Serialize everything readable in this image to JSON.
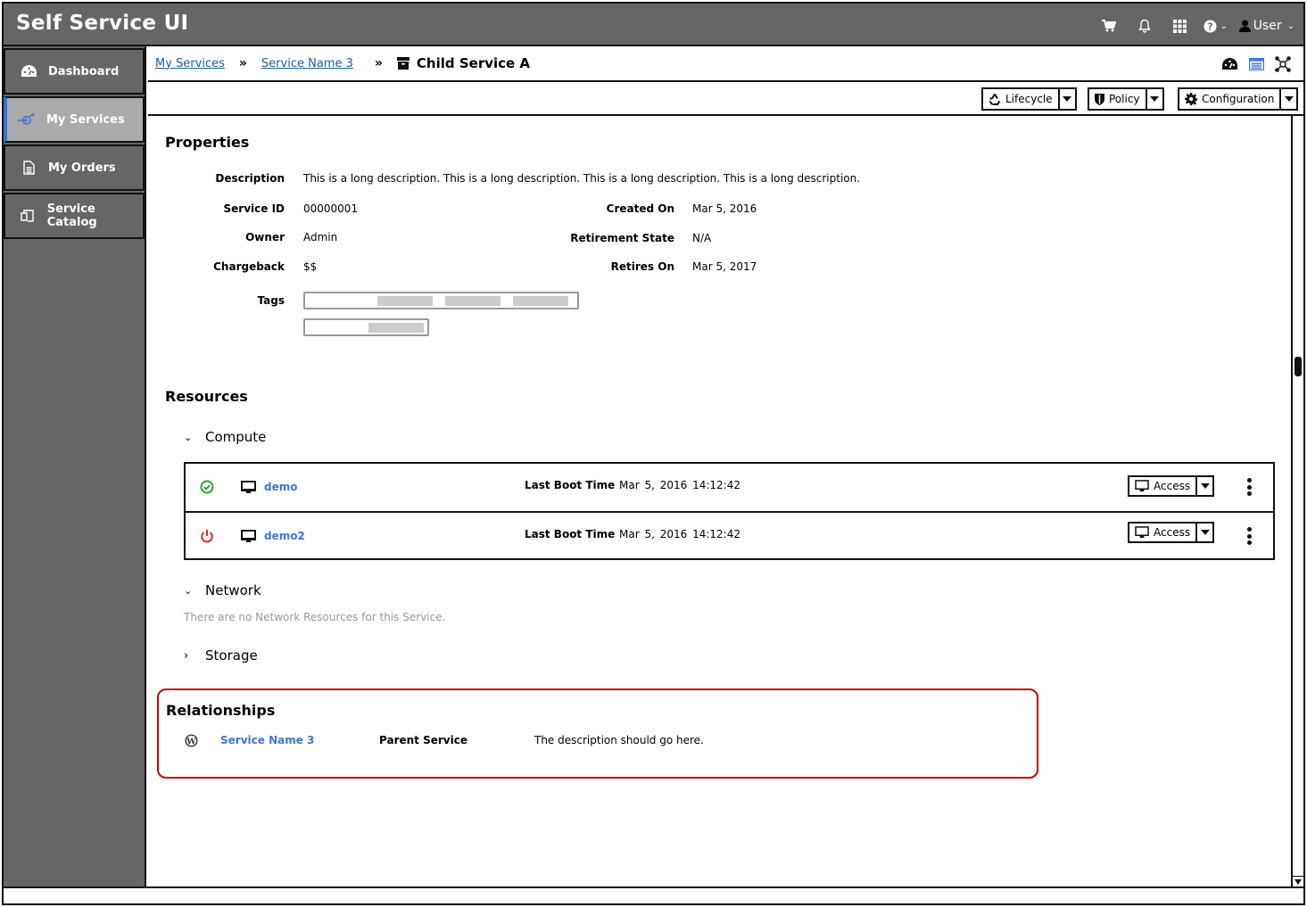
{
  "app": {
    "title": "Self Service UI",
    "header_icons": [
      {
        "name": "cart-icon"
      },
      {
        "name": "bell-icon"
      },
      {
        "name": "apps-grid-icon"
      },
      {
        "name": "help-icon"
      }
    ],
    "user_label": "User"
  },
  "sidebar": {
    "items": [
      {
        "label": "Dashboard",
        "icon": "dashboard-icon",
        "active": false
      },
      {
        "label": "My Services",
        "icon": "services-icon",
        "active": true
      },
      {
        "label": "My Orders",
        "icon": "document-icon",
        "active": false
      },
      {
        "label": "Service Catalog",
        "icon": "catalog-icon",
        "active": false
      }
    ]
  },
  "breadcrumb": {
    "items": [
      {
        "label": "My Services"
      },
      {
        "label": "Service Name 3"
      }
    ],
    "separator": "»",
    "current": "Child Service A"
  },
  "view_icons": [
    "dashboard-view-icon",
    "list-view-icon",
    "topology-view-icon"
  ],
  "toolbar": {
    "lifecycle": "Lifecycle",
    "policy": "Policy",
    "configuration": "Configuration"
  },
  "properties": {
    "title": "Properties",
    "description_label": "Description",
    "description": "This is a long description. This is a long description. This is a long description. This is a long description.",
    "service_id_label": "Service ID",
    "service_id": "00000001",
    "owner_label": "Owner",
    "owner": "Admin",
    "chargeback_label": "Chargeback",
    "chargeback": "$$",
    "tags_label": "Tags",
    "created_on_label": "Created On",
    "created_on": "Mar 5, 2016",
    "retirement_state_label": "Retirement State",
    "retirement_state": "N/A",
    "retires_on_label": "Retires On",
    "retires_on": "Mar 5, 2017"
  },
  "resources": {
    "title": "Resources",
    "compute": {
      "label": "Compute",
      "expanded": true,
      "rows": [
        {
          "name": "demo",
          "status": "running",
          "status_color": "#2ea02e",
          "boot_label": "Last Boot Time",
          "boot_time": "Mar 5, 2016  14:12:42",
          "access_label": "Access"
        },
        {
          "name": "demo2",
          "status": "off",
          "status_color": "#d62c2c",
          "boot_label": "Last Boot Time",
          "boot_time": "Mar 5, 2016  14:12:42",
          "access_label": "Access"
        }
      ]
    },
    "network": {
      "label": "Network",
      "expanded": true,
      "empty_message": "There are no Network Resources for this Service."
    },
    "storage": {
      "label": "Storage",
      "expanded": false
    }
  },
  "relationships": {
    "title": "Relationships",
    "rows": [
      {
        "name": "Service Name 3",
        "type": "Parent Service",
        "description": "The description should go here."
      }
    ],
    "highlight_color": "#cc0000"
  },
  "colors": {
    "chrome": "#666666",
    "active_nav": "#aaaaaa",
    "accent": "#3b6fd8",
    "link": "#3b78d8"
  }
}
